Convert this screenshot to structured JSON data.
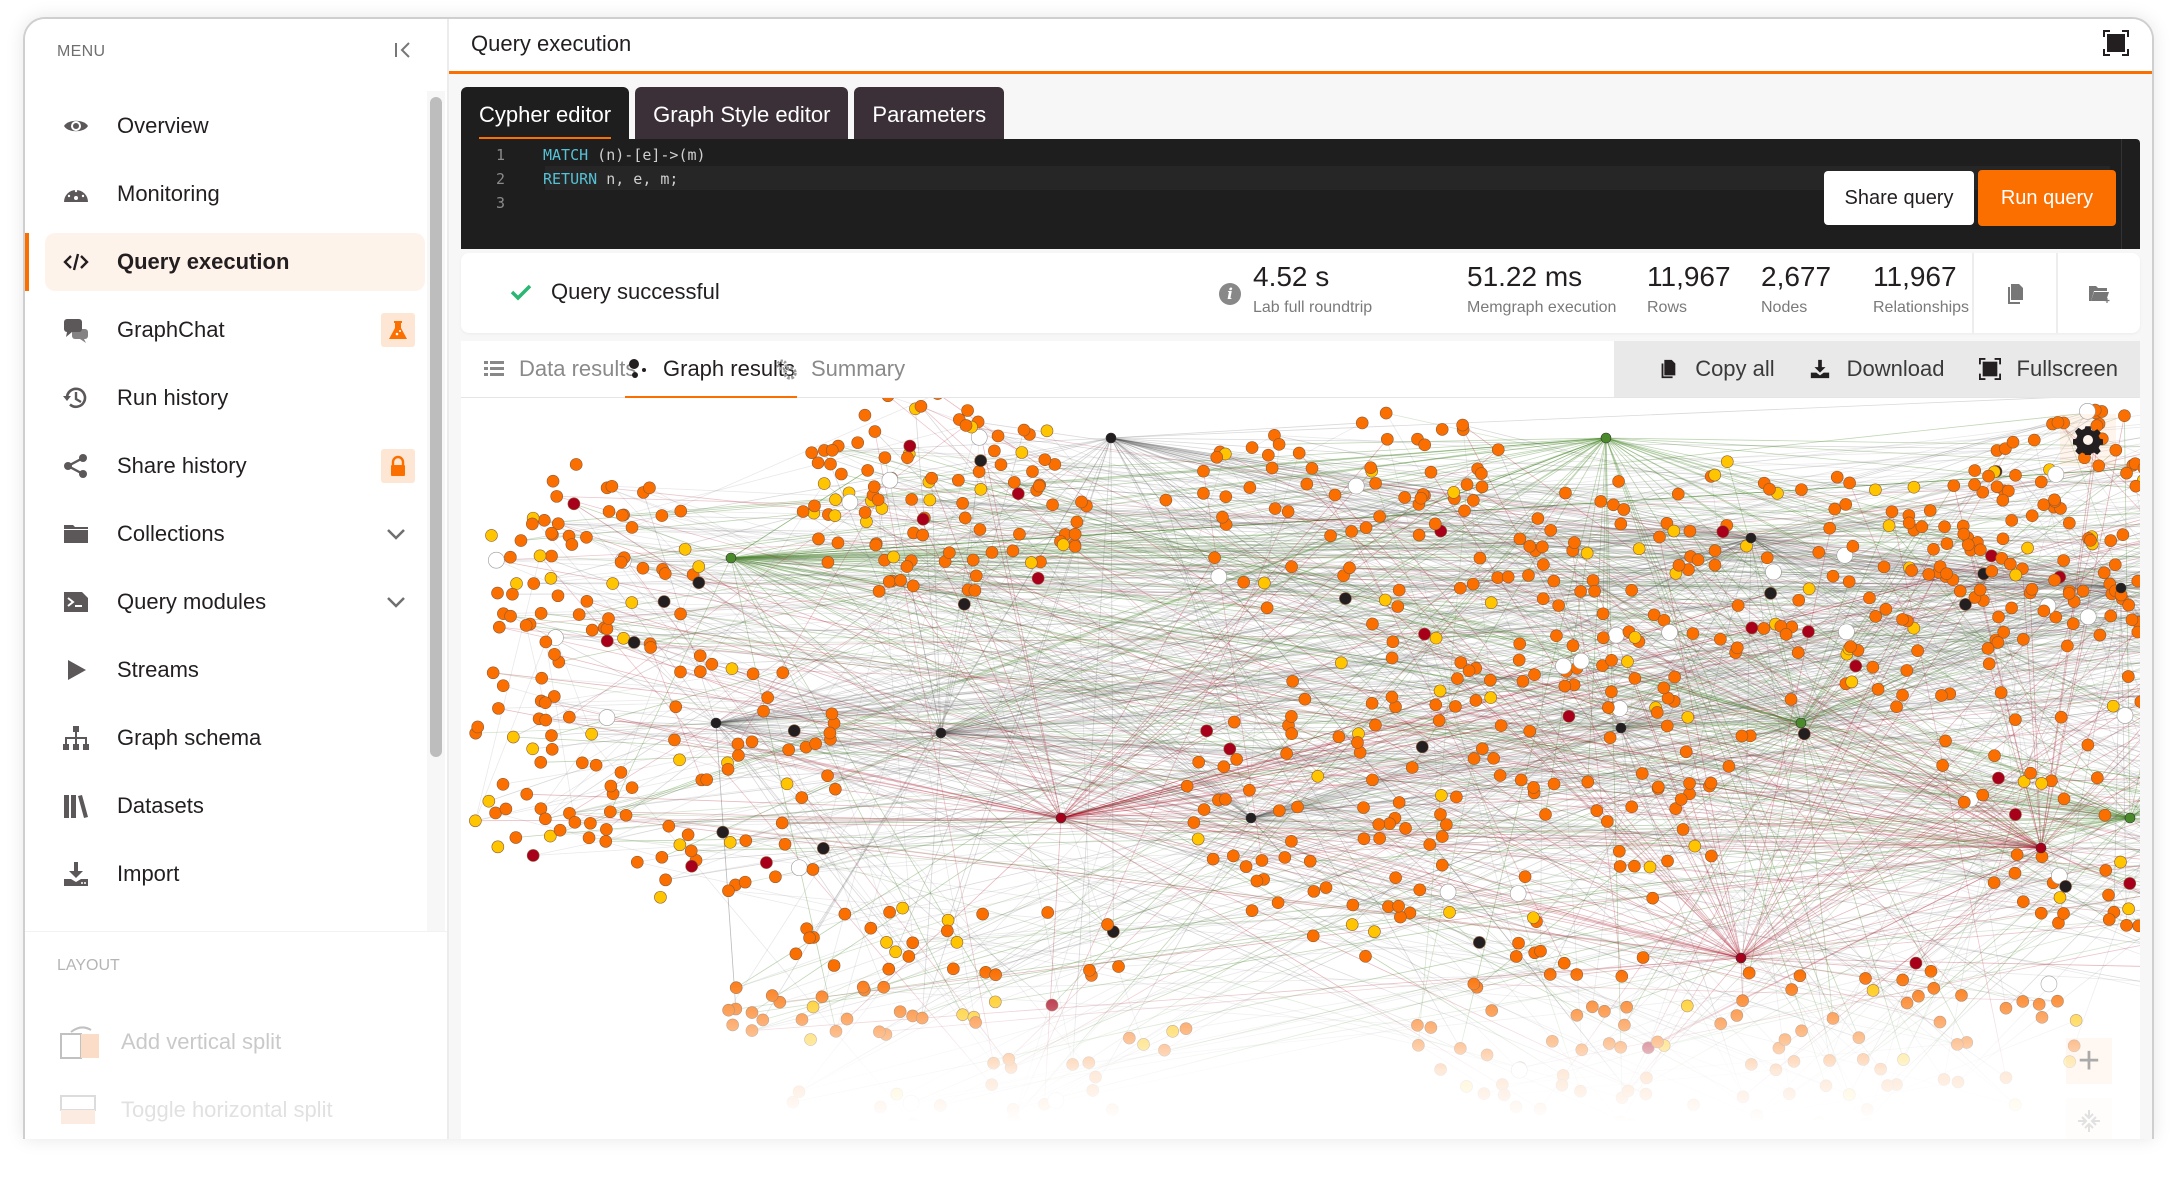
{
  "sidebar": {
    "menu_heading": "MENU",
    "items": [
      {
        "label": "Overview",
        "icon": "eye-icon"
      },
      {
        "label": "Monitoring",
        "icon": "gauge-icon"
      },
      {
        "label": "Query execution",
        "icon": "code-icon",
        "active": true
      },
      {
        "label": "GraphChat",
        "icon": "chat-icon",
        "badge": "flask-icon"
      },
      {
        "label": "Run history",
        "icon": "history-icon"
      },
      {
        "label": "Share history",
        "icon": "share-icon",
        "badge": "lock-icon"
      },
      {
        "label": "Collections",
        "icon": "folder-icon",
        "expandable": true
      },
      {
        "label": "Query modules",
        "icon": "terminal-icon",
        "expandable": true
      },
      {
        "label": "Streams",
        "icon": "play-icon"
      },
      {
        "label": "Graph schema",
        "icon": "sitemap-icon"
      },
      {
        "label": "Datasets",
        "icon": "books-icon"
      },
      {
        "label": "Import",
        "icon": "import-icon"
      }
    ],
    "layout_heading": "LAYOUT",
    "layout_items": [
      {
        "label": "Add vertical split",
        "icon": "vertical-split-icon"
      },
      {
        "label": "Toggle horizontal split",
        "icon": "horizontal-split-icon"
      }
    ]
  },
  "main": {
    "title": "Query execution",
    "editor_tabs": [
      {
        "label": "Cypher editor",
        "active": true
      },
      {
        "label": "Graph Style editor"
      },
      {
        "label": "Parameters"
      }
    ],
    "code_lines": [
      {
        "n": "1",
        "kw": "MATCH",
        "rest": " (n)-[e]->(m)"
      },
      {
        "n": "2",
        "kw": "RETURN",
        "rest": " n, e, m;"
      },
      {
        "n": "3",
        "kw": "",
        "rest": ""
      }
    ],
    "share_label": "Share query",
    "run_label": "Run query",
    "status": "Query successful",
    "stats": [
      {
        "value": "4.52 s",
        "label": "Lab full roundtrip"
      },
      {
        "value": "51.22 ms",
        "label": "Memgraph execution"
      },
      {
        "value": "11,967",
        "label": "Rows"
      },
      {
        "value": "2,677",
        "label": "Nodes"
      },
      {
        "value": "11,967",
        "label": "Relationships"
      }
    ],
    "result_tabs": [
      {
        "label": "Data results",
        "icon": "list-icon"
      },
      {
        "label": "Graph results",
        "icon": "graph-icon",
        "active": true
      },
      {
        "label": "Summary",
        "icon": "cogs-icon"
      }
    ],
    "actions": [
      {
        "label": "Copy all",
        "icon": "copy-icon"
      },
      {
        "label": "Download",
        "icon": "download-icon"
      },
      {
        "label": "Fullscreen",
        "icon": "fullscreen-icon"
      }
    ],
    "zoom_in": "+",
    "colors": {
      "accent": "#fb6e00",
      "node_orange": "#fb6e00",
      "node_yellow": "#ffc500",
      "node_green": "#4a8a2a",
      "node_red": "#a8001a",
      "node_black": "#231f20",
      "node_white": "#ffffff",
      "success": "#2bb673"
    }
  }
}
